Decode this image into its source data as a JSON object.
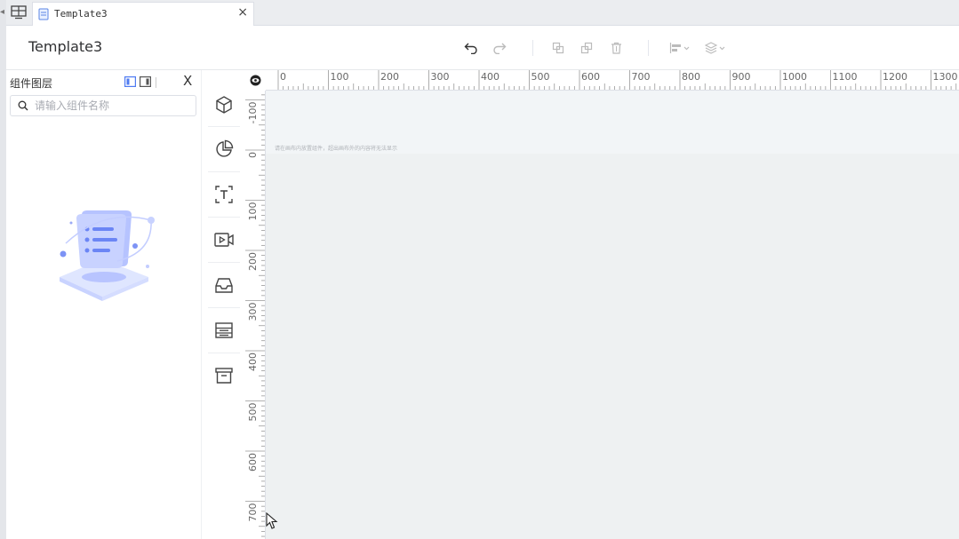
{
  "tab": {
    "label": "Template3",
    "close": "×"
  },
  "header": {
    "title": "Template3"
  },
  "toolbar": {
    "undo": "undo-icon",
    "redo": "redo-icon",
    "copy": "copy-icon",
    "paste": "paste-icon",
    "delete": "trash-icon",
    "align": "align-icon",
    "layer": "layer-icon"
  },
  "layer_panel": {
    "title": "组件图层",
    "close": "X",
    "search_placeholder": "请输入组件名称"
  },
  "component_bar": [
    "cube-icon",
    "pie-chart-icon",
    "text-icon",
    "video-icon",
    "inbox-icon",
    "form-icon",
    "archive-icon"
  ],
  "ruler": {
    "h_labels": [
      "0",
      "100",
      "200",
      "300",
      "400",
      "500",
      "600",
      "700",
      "800",
      "900",
      "1000",
      "1100",
      "1200",
      "1300"
    ],
    "v_labels": [
      "-100",
      "0",
      "100",
      "200",
      "300",
      "400",
      "500",
      "600",
      "700"
    ]
  },
  "canvas": {
    "hint": "请在画布内放置组件，超出画布外的内容将无法显示"
  },
  "colors": {
    "accent": "#6b8cff",
    "bg": "#f2f5f7"
  }
}
